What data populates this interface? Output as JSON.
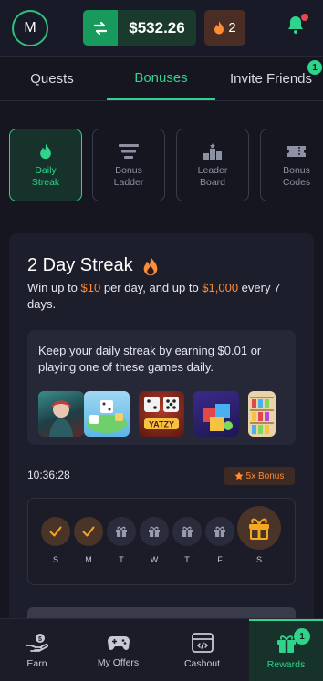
{
  "header": {
    "avatar_letter": "M",
    "balance": "$532.26",
    "streak_count": "2"
  },
  "tabs": [
    {
      "label": "Quests"
    },
    {
      "label": "Bonuses"
    },
    {
      "label": "Invite Friends",
      "badge": "1"
    }
  ],
  "subtabs": [
    {
      "label": "Daily Streak",
      "icon": "flame-icon"
    },
    {
      "label": "Bonus Ladder",
      "icon": "ladder-icon"
    },
    {
      "label": "Leader Board",
      "icon": "podium-icon"
    },
    {
      "label": "Bonus Codes",
      "icon": "ticket-icon"
    }
  ],
  "streak": {
    "title": "2 Day Streak",
    "subtitle_part1": "Win up to ",
    "subtitle_amount1": "$10",
    "subtitle_part2": " per day, and up to ",
    "subtitle_amount2": "$1,000",
    "subtitle_part3": " every 7 days.",
    "games_text": "Keep your daily streak by earning $0.01 or playing one of these games daily.",
    "games": [
      "game-thumb-warrior",
      "game-thumb-dice-board",
      "game-thumb-yatzy",
      "game-thumb-puzzle",
      "game-thumb-sort"
    ],
    "yatzy_label": "YATZY",
    "timer": "10:36:28",
    "bonus_badge": "5x Bonus",
    "days": [
      {
        "label": "S",
        "state": "done"
      },
      {
        "label": "M",
        "state": "done"
      },
      {
        "label": "T",
        "state": "gift"
      },
      {
        "label": "W",
        "state": "gift"
      },
      {
        "label": "T",
        "state": "gift"
      },
      {
        "label": "F",
        "state": "gift"
      },
      {
        "label": "S",
        "state": "big-gift"
      }
    ]
  },
  "bottom_nav": [
    {
      "label": "Earn",
      "icon": "hand-coin-icon"
    },
    {
      "label": "My Offers",
      "icon": "gamepad-icon"
    },
    {
      "label": "Cashout",
      "icon": "cashout-icon"
    },
    {
      "label": "Rewards",
      "icon": "gift-icon",
      "badge": "1"
    }
  ],
  "colors": {
    "accent": "#2fd38b",
    "orange": "#ff8c36",
    "background": "#161621"
  }
}
